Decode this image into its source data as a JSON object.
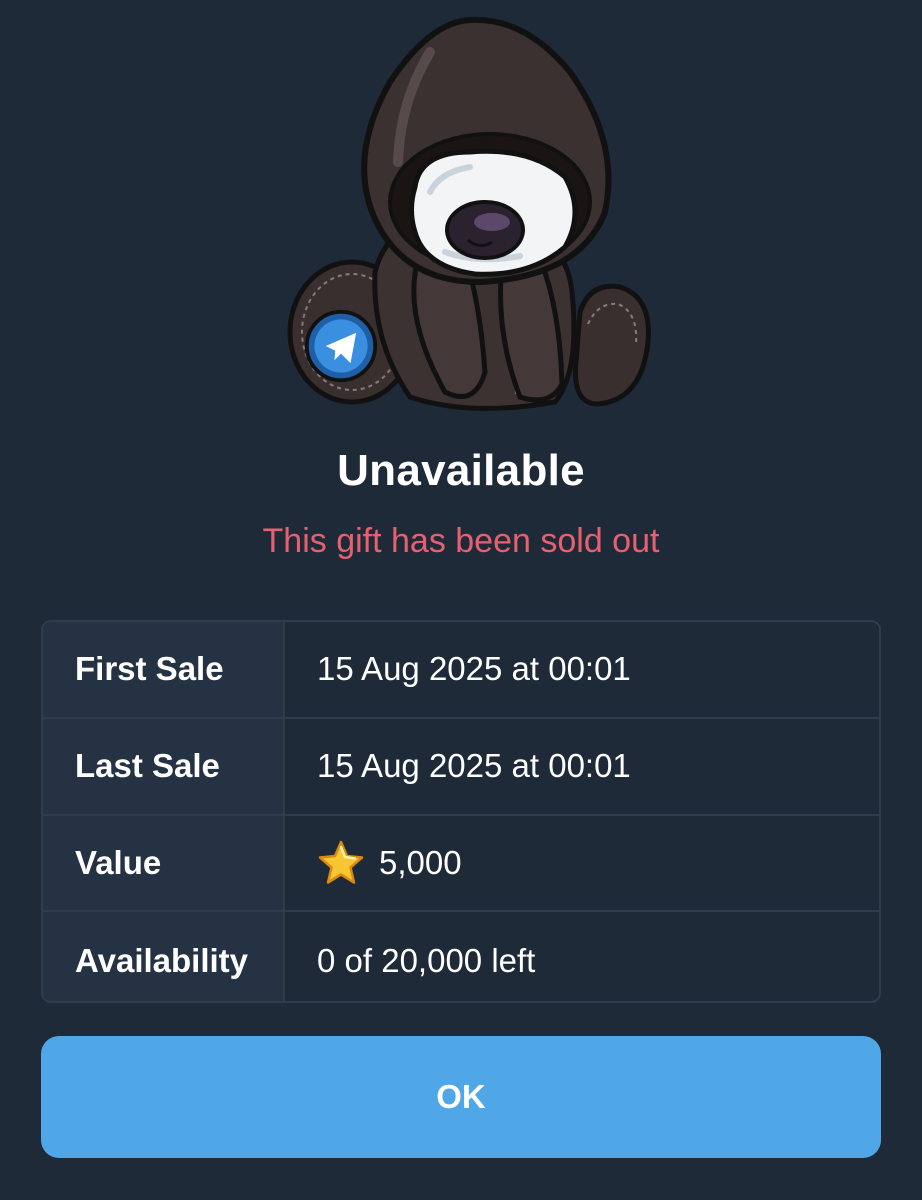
{
  "gift": {
    "title": "Unavailable",
    "status_message": "This gift has been sold out",
    "badge_icon": "telegram-logo-icon",
    "illustration": "hooded-teddy-bear"
  },
  "details": [
    {
      "label": "First Sale",
      "value": "15 Aug 2025 at 00:01"
    },
    {
      "label": "Last Sale",
      "value": "15 Aug 2025 at 00:01"
    },
    {
      "label": "Value",
      "value": "5,000",
      "icon": "star-icon"
    },
    {
      "label": "Availability",
      "value": "0 of 20,000 left"
    }
  ],
  "actions": {
    "ok_label": "OK"
  },
  "colors": {
    "background": "#1f2a38",
    "status_red": "#e8606f",
    "button_blue": "#50a7e8",
    "label_cell": "#253244",
    "border": "#2f3c4d"
  }
}
